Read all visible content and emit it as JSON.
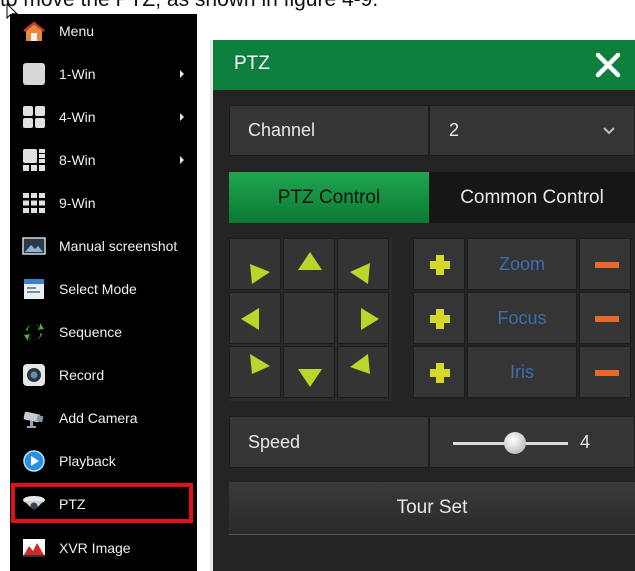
{
  "caption": "to move the PTZ, as shown in figure 4-9.",
  "menu": {
    "items": [
      {
        "label": "Menu",
        "icon": "home-icon",
        "submenu": false
      },
      {
        "label": "1-Win",
        "icon": "single-window-icon",
        "submenu": true
      },
      {
        "label": "4-Win",
        "icon": "quad-window-icon",
        "submenu": true
      },
      {
        "label": "8-Win",
        "icon": "eight-window-icon",
        "submenu": true
      },
      {
        "label": "9-Win",
        "icon": "nine-window-icon",
        "submenu": false
      },
      {
        "label": "Manual screenshot",
        "icon": "screenshot-icon",
        "submenu": false
      },
      {
        "label": "Select Mode",
        "icon": "select-mode-icon",
        "submenu": false
      },
      {
        "label": "Sequence",
        "icon": "sequence-icon",
        "submenu": false
      },
      {
        "label": "Record",
        "icon": "record-icon",
        "submenu": false
      },
      {
        "label": "Add Camera",
        "icon": "camera-icon",
        "submenu": false
      },
      {
        "label": "Playback",
        "icon": "playback-icon",
        "submenu": false
      },
      {
        "label": "PTZ",
        "icon": "ptz-camera-icon",
        "submenu": false
      },
      {
        "label": "XVR Image",
        "icon": "image-settings-icon",
        "submenu": false
      }
    ],
    "highlighted": "PTZ",
    "highlight_color": "#e0101a"
  },
  "ptz": {
    "title": "PTZ",
    "accent_color": "#0d7f3c",
    "channel_label": "Channel",
    "channel_value": "2",
    "tabs": {
      "active": "PTZ Control",
      "inactive": "Common Control"
    },
    "lens": [
      {
        "label": "Zoom"
      },
      {
        "label": "Focus"
      },
      {
        "label": "Iris"
      }
    ],
    "speed_label": "Speed",
    "speed_value": "4",
    "tour_set_label": "Tour Set"
  }
}
